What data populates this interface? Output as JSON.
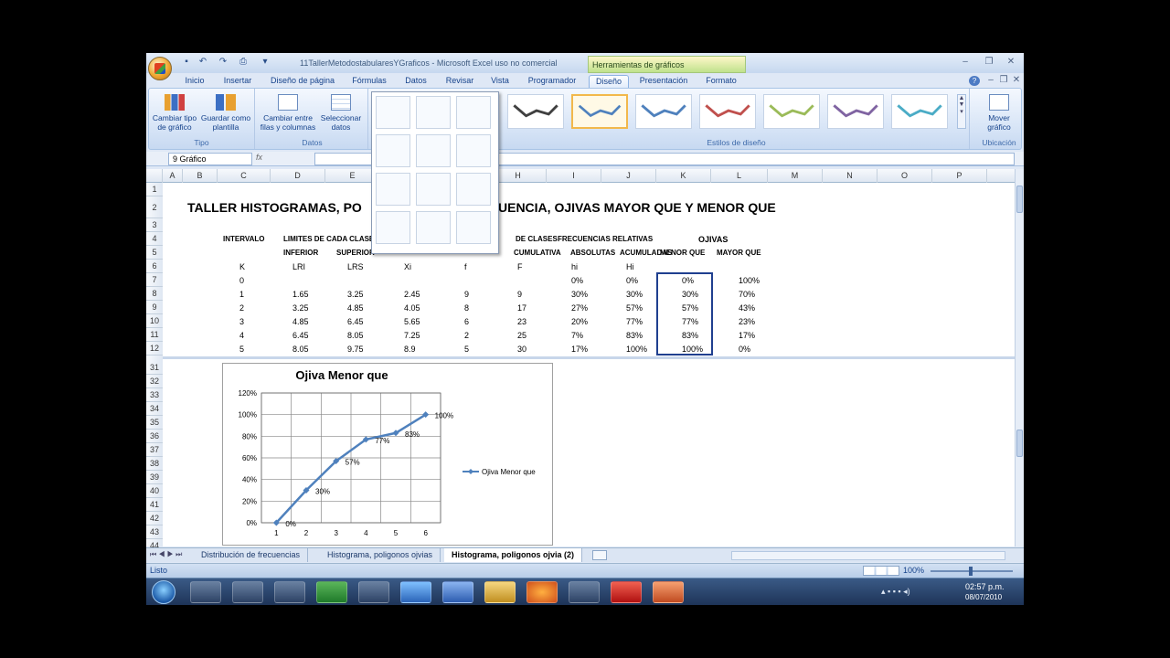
{
  "window": {
    "title": "11TallerMetodostabularesYGraficos - Microsoft Excel uso no comercial",
    "context_header": "Herramientas de gráficos"
  },
  "tabs": [
    "Inicio",
    "Insertar",
    "Diseño de página",
    "Fórmulas",
    "Datos",
    "Revisar",
    "Vista",
    "Programador",
    "Diseño",
    "Presentación",
    "Formato"
  ],
  "ribbon": {
    "tipo": {
      "label": "Tipo",
      "cambiar": "Cambiar tipo",
      "cambiar2": "de gráfico",
      "guardar": "Guardar como",
      "guardar2": "plantilla"
    },
    "datos": {
      "label": "Datos",
      "cambiar": "Cambiar entre",
      "cambiar2": "filas y columnas",
      "seleccionar": "Seleccionar",
      "seleccionar2": "datos"
    },
    "estilos_label": "Estilos de diseño",
    "ubicacion": {
      "label": "Ubicación",
      "mover": "Mover",
      "mover2": "gráfico"
    },
    "style_colors": [
      "#404040",
      "#4f81bd",
      "#4f81bd",
      "#c0504d",
      "#9bbb59",
      "#8064a2",
      "#4bacc6"
    ]
  },
  "namebox": "9 Gráfico",
  "fx": "fx",
  "columns": [
    "A",
    "B",
    "C",
    "D",
    "E",
    "F",
    "G",
    "H",
    "I",
    "J",
    "K",
    "L",
    "M",
    "N",
    "O",
    "P"
  ],
  "rows": [
    "1",
    "2",
    "3",
    "4",
    "5",
    "6",
    "7",
    "8",
    "9",
    "10",
    "11",
    "12",
    "31",
    "32",
    "33",
    "34",
    "35",
    "36",
    "37",
    "38",
    "39",
    "40",
    "41",
    "42",
    "43",
    "44"
  ],
  "sheet": {
    "title": "TALLER HISTOGRAMAS, PO",
    "title_tail": "UENCIA, OJIVAS MAYOR QUE Y MENOR QUE",
    "h_intervalo": "INTERVALO",
    "h_limites": "LIMITES DE CADA CLASE",
    "h_inferior": "INFERIOR",
    "h_superior": "SUPERIOR",
    "h_declases": "DE CLASES",
    "h_cumulativa": "CUMULATIVA",
    "h_frecrel": "FRECUENCIAS RELATIVAS",
    "h_absolutas": "ABSOLUTAS",
    "h_acumuladas": "ACUMULADAS",
    "h_ojivas": "OJIVAS",
    "h_menor": "MENOR QUE",
    "h_mayor": "MAYOR QUE",
    "sub": [
      "K",
      "LRI",
      "LRS",
      "Xi",
      "f",
      "F",
      "hi",
      "Hi"
    ],
    "data": [
      [
        "0",
        "",
        "",
        "",
        "",
        "",
        "0%",
        "0%",
        "0%",
        "100%"
      ],
      [
        "1",
        "1.65",
        "3.25",
        "2.45",
        "9",
        "9",
        "30%",
        "30%",
        "30%",
        "70%"
      ],
      [
        "2",
        "3.25",
        "4.85",
        "4.05",
        "8",
        "17",
        "27%",
        "57%",
        "57%",
        "43%"
      ],
      [
        "3",
        "4.85",
        "6.45",
        "5.65",
        "6",
        "23",
        "20%",
        "77%",
        "77%",
        "23%"
      ],
      [
        "4",
        "6.45",
        "8.05",
        "7.25",
        "2",
        "25",
        "7%",
        "83%",
        "83%",
        "17%"
      ],
      [
        "5",
        "8.05",
        "9.75",
        "8.9",
        "5",
        "30",
        "17%",
        "100%",
        "100%",
        "0%"
      ]
    ]
  },
  "chart_data": {
    "type": "line",
    "title": "Ojiva Menor que",
    "categories": [
      "1",
      "2",
      "3",
      "4",
      "5",
      "6"
    ],
    "series": [
      {
        "name": "Ojiva Menor que",
        "values": [
          0,
          30,
          57,
          77,
          83,
          100
        ]
      }
    ],
    "data_labels": [
      "0%",
      "30%",
      "57%",
      "77%",
      "83%",
      "100%"
    ],
    "y_ticks": [
      "0%",
      "20%",
      "40%",
      "60%",
      "80%",
      "100%",
      "120%"
    ],
    "ylim": [
      0,
      120
    ],
    "grid": true,
    "legend": "right"
  },
  "sheet_tabs": [
    "Distribución de frecuencias",
    "Histograma, poligonos ojvias",
    "Histograma, poligonos ojvia (2)"
  ],
  "status": {
    "listo": "Listo",
    "zoom": "100%"
  },
  "clock": {
    "time": "02:57 p.m.",
    "date": "08/07/2010"
  }
}
